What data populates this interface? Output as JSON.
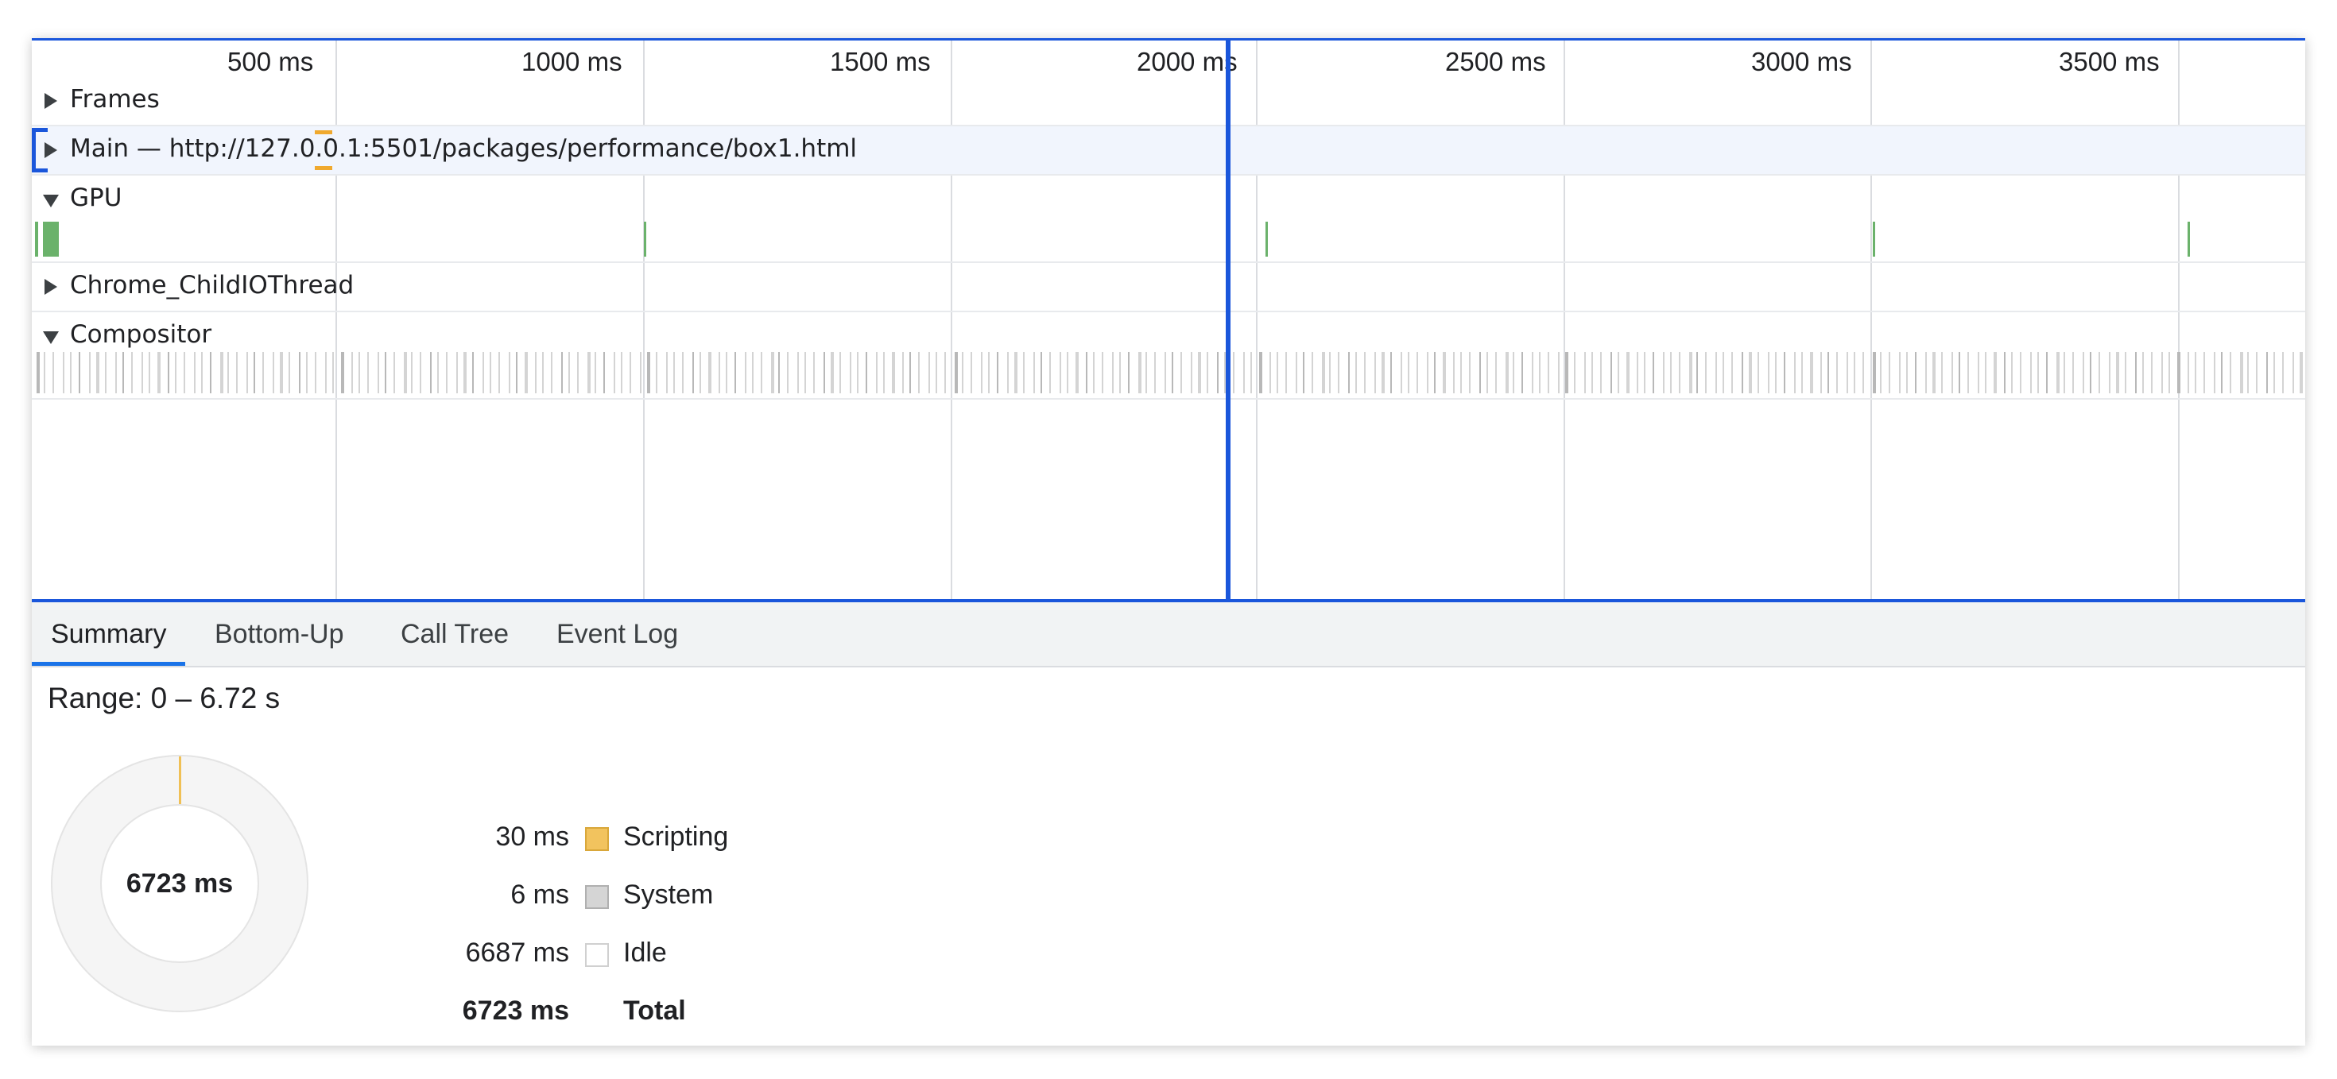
{
  "timeline": {
    "ticks": [
      "500 ms",
      "1000 ms",
      "1500 ms",
      "2000 ms",
      "2500 ms",
      "3000 ms",
      "3500 ms"
    ],
    "tracks": {
      "frames": "Frames",
      "main": "Main — http://127.0.0.1:5501/packages/performance/box1.html",
      "gpu": "GPU",
      "childio": "Chrome_ChildIOThread",
      "compositor": "Compositor"
    }
  },
  "tabs": [
    "Summary",
    "Bottom-Up",
    "Call Tree",
    "Event Log"
  ],
  "active_tab": "Summary",
  "summary": {
    "range": "Range: 0 – 6.72 s",
    "donut_center": "6723 ms",
    "legend": [
      {
        "value": "30 ms",
        "name": "Scripting",
        "color": "#f2c35e"
      },
      {
        "value": "6 ms",
        "name": "System",
        "color": "#d5d5d5"
      },
      {
        "value": "6687 ms",
        "name": "Idle",
        "color": "#ffffff"
      }
    ],
    "total": {
      "value": "6723 ms",
      "name": "Total"
    }
  },
  "colors": {
    "accent": "#1a56db",
    "gpu": "#6bb26b",
    "compositor": "#c9c9c9",
    "scripting": "#f2c35e"
  }
}
